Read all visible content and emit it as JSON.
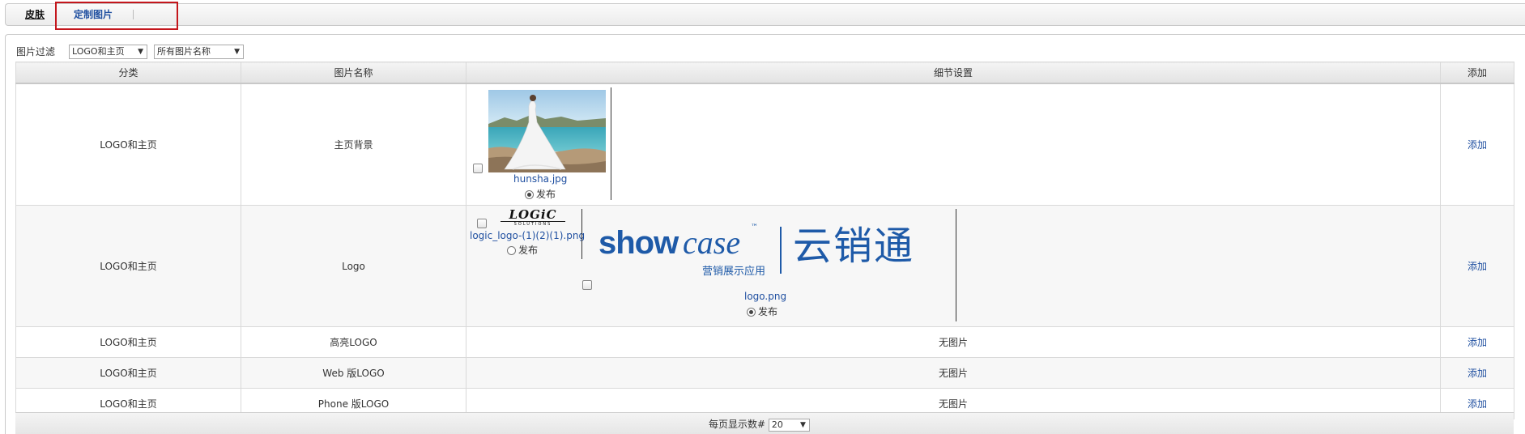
{
  "tabs": [
    {
      "label": "皮肤"
    },
    {
      "label": "定制图片"
    }
  ],
  "filter": {
    "label": "图片过滤",
    "category_value": "LOGO和主页",
    "name_value": "所有图片名称"
  },
  "table": {
    "headers": [
      "分类",
      "图片名称",
      "细节设置",
      "添加"
    ],
    "rows": [
      {
        "category": "LOGO和主页",
        "name": "主页背景",
        "add": "添加"
      },
      {
        "category": "LOGO和主页",
        "name": "Logo",
        "add": "添加"
      },
      {
        "category": "LOGO和主页",
        "name": "高亮LOGO",
        "detail": "无图片",
        "add": "添加"
      },
      {
        "category": "LOGO和主页",
        "name": "Web 版LOGO",
        "detail": "无图片",
        "add": "添加"
      },
      {
        "category": "LOGO和主页",
        "name": "Phone 版LOGO",
        "detail": "无图片",
        "add": "添加"
      }
    ]
  },
  "images": {
    "hunsha": {
      "filename": "hunsha.jpg",
      "publish": "发布"
    },
    "logic": {
      "filename": "logic_logo-(1)(2)(1).png",
      "publish": "发布",
      "logo_text": "LOGiC",
      "logo_sub": "SOLUTIONS"
    },
    "showcase": {
      "filename": "logo.png",
      "publish": "发布",
      "brand_show": "show",
      "brand_case": "case",
      "tm": "™",
      "tagline": "营销展示应用",
      "cn": "云销通"
    }
  },
  "footer": {
    "per_page_label": "每页显示数#",
    "per_page_value": "20"
  }
}
